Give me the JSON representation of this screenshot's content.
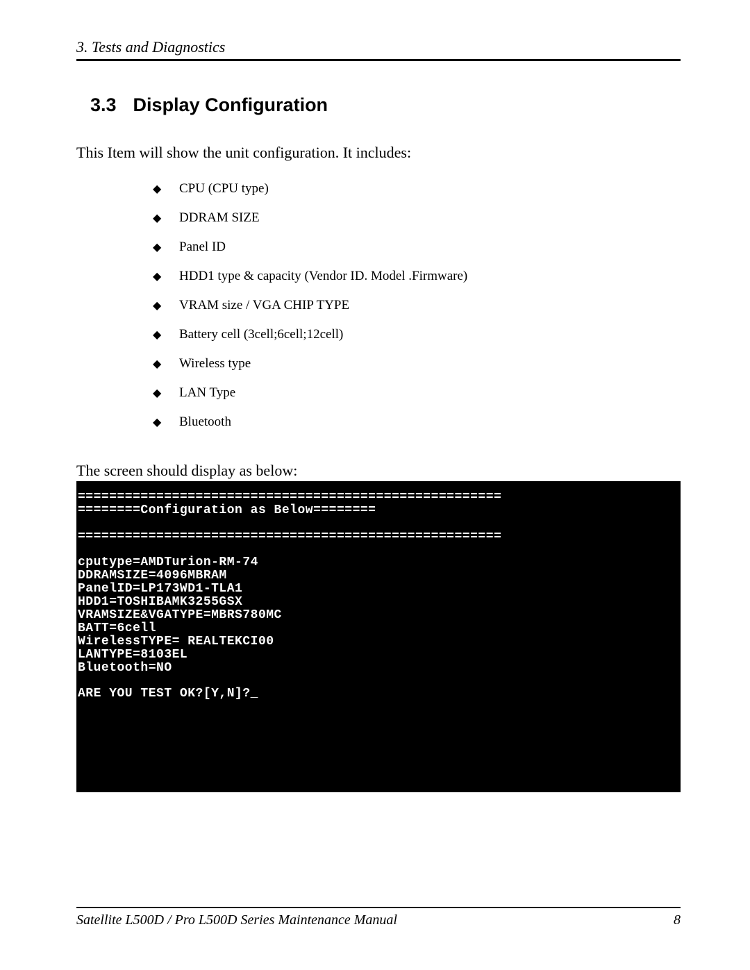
{
  "header": {
    "chapter": "3.  Tests and Diagnostics"
  },
  "section": {
    "number": "3.3",
    "title": "Display Configuration"
  },
  "intro": "This Item will show the unit configuration. It includes:",
  "bullets": [
    "CPU (CPU type)",
    "DDRAM SIZE",
    "Panel ID",
    "HDD1 type & capacity (Vendor ID. Model .Firmware)",
    "VRAM  size / VGA CHIP TYPE",
    "Battery cell (3cell;6cell;12cell)",
    "Wireless type",
    "LAN Type",
    "Bluetooth"
  ],
  "screen_intro": "The screen should display as below:",
  "console": {
    "divider": "======================================================",
    "title_left": "========",
    "title_center": "Configuration as Below",
    "title_right": "========",
    "lines": [
      "cputype=AMDTurion-RM-74",
      "DDRAMSIZE=4096MBRAM",
      "PanelID=LP173WD1-TLA1",
      "HDD1=TOSHIBAMK3255GSX",
      "VRAMSIZE&VGATYPE=MBRS780MC",
      "BATT=6cell",
      "WirelessTYPE= REALTEKCI00",
      "LANTYPE=8103EL",
      "Bluetooth=NO"
    ],
    "prompt": "ARE YOU TEST OK?[Y,N]?_"
  },
  "footer": {
    "title": "Satellite L500D / Pro L500D Series Maintenance Manual",
    "page": "8"
  }
}
